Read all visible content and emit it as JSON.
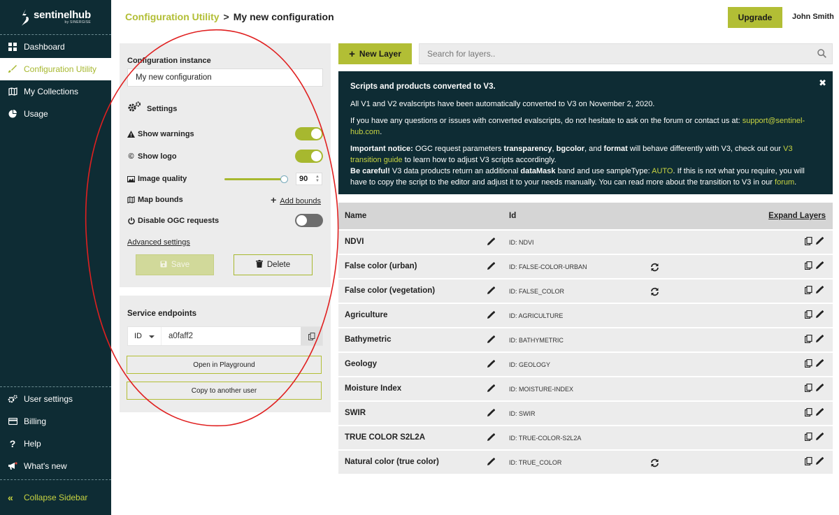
{
  "brand": {
    "name": "sentinelhub",
    "sub": "by SINERGISE"
  },
  "sidebar": {
    "items": [
      {
        "label": "Dashboard",
        "icon": "grid-icon"
      },
      {
        "label": "Configuration Utility",
        "icon": "palette-icon",
        "active": true
      },
      {
        "label": "My Collections",
        "icon": "map-icon"
      },
      {
        "label": "Usage",
        "icon": "pie-chart-icon"
      }
    ],
    "bottom_items": [
      {
        "label": "User settings",
        "icon": "gears-icon"
      },
      {
        "label": "Billing",
        "icon": "credit-card-icon"
      },
      {
        "label": "Help",
        "icon": "question-icon"
      },
      {
        "label": "What's new",
        "icon": "megaphone-icon"
      }
    ],
    "collapse_label": "Collapse Sidebar"
  },
  "header": {
    "breadcrumb_root": "Configuration Utility",
    "breadcrumb_sep": ">",
    "breadcrumb_current": "My new configuration",
    "upgrade_label": "Upgrade",
    "user": "John Smith"
  },
  "config": {
    "instance_label": "Configuration instance",
    "instance_value": "My new configuration",
    "settings_label": "Settings",
    "show_warnings": "Show warnings",
    "show_logo": "Show logo",
    "image_quality": "Image quality",
    "image_quality_value": "90",
    "image_quality_level": 0.9,
    "map_bounds": "Map bounds",
    "add_bounds": "Add bounds",
    "disable_ogc": "Disable OGC requests",
    "toggles": {
      "show_warnings": true,
      "show_logo": true,
      "disable_ogc": false
    },
    "advanced": "Advanced settings",
    "save_label": "Save",
    "delete_label": "Delete"
  },
  "service": {
    "label": "Service endpoints",
    "select_value": "ID",
    "id_value": "a0faff2",
    "open_playground": "Open in Playground",
    "copy_user": "Copy to another user"
  },
  "layers": {
    "new_layer_label": "New Layer",
    "search_placeholder": "Search for layers..",
    "notice": {
      "title": "Scripts and products converted to V3.",
      "p1": "All V1 and V2 evalscripts have been automatically converted to V3 on November 2, 2020.",
      "p2_text": "If you have any questions or issues with converted evalscripts, do not hesitate to ask on the forum or contact us at: ",
      "p2_email": "support@sentinel-hub.com",
      "p2_end": ".",
      "imp_label": "Important notice:",
      "imp_t1": " OGC request parameters ",
      "imp_b1": "transparency",
      "imp_t2": ", ",
      "imp_b2": "bgcolor",
      "imp_t3": ", and ",
      "imp_b3": "format",
      "imp_t4": " will behave differently with V3, check out our ",
      "imp_link": "V3 transition guide",
      "imp_t5": " to learn how to adjust V3 scripts accordingly.",
      "careful_label": "Be careful!",
      "car_t1": " V3 data products return an additional ",
      "car_b1": "dataMask",
      "car_t2": " band and use sampleType: ",
      "car_hl": "AUTO",
      "car_t3": ". If this is not what you require, you will have to copy the script to the editor and adjust it to your needs manually. You can read more about the transition to V3 in our ",
      "car_link": "forum",
      "car_end": "."
    },
    "col_name": "Name",
    "col_id": "Id",
    "expand": "Expand Layers",
    "rows": [
      {
        "name": "NDVI",
        "id": "ID: NDVI",
        "sync": false
      },
      {
        "name": "False color (urban)",
        "id": "ID: FALSE-COLOR-URBAN",
        "sync": true
      },
      {
        "name": "False color (vegetation)",
        "id": "ID: FALSE_COLOR",
        "sync": true
      },
      {
        "name": "Agriculture",
        "id": "ID: AGRICULTURE",
        "sync": false
      },
      {
        "name": "Bathymetric",
        "id": "ID: BATHYMETRIC",
        "sync": false
      },
      {
        "name": "Geology",
        "id": "ID: GEOLOGY",
        "sync": false
      },
      {
        "name": "Moisture Index",
        "id": "ID: MOISTURE-INDEX",
        "sync": false
      },
      {
        "name": "SWIR",
        "id": "ID: SWIR",
        "sync": false
      },
      {
        "name": "TRUE COLOR S2L2A",
        "id": "ID: TRUE-COLOR-S2L2A",
        "sync": false
      },
      {
        "name": "Natural color (true color)",
        "id": "ID: TRUE_COLOR",
        "sync": true
      }
    ]
  },
  "colors": {
    "accent": "#b2be35",
    "dark": "#0e2c34",
    "annotation": "#e02020"
  }
}
